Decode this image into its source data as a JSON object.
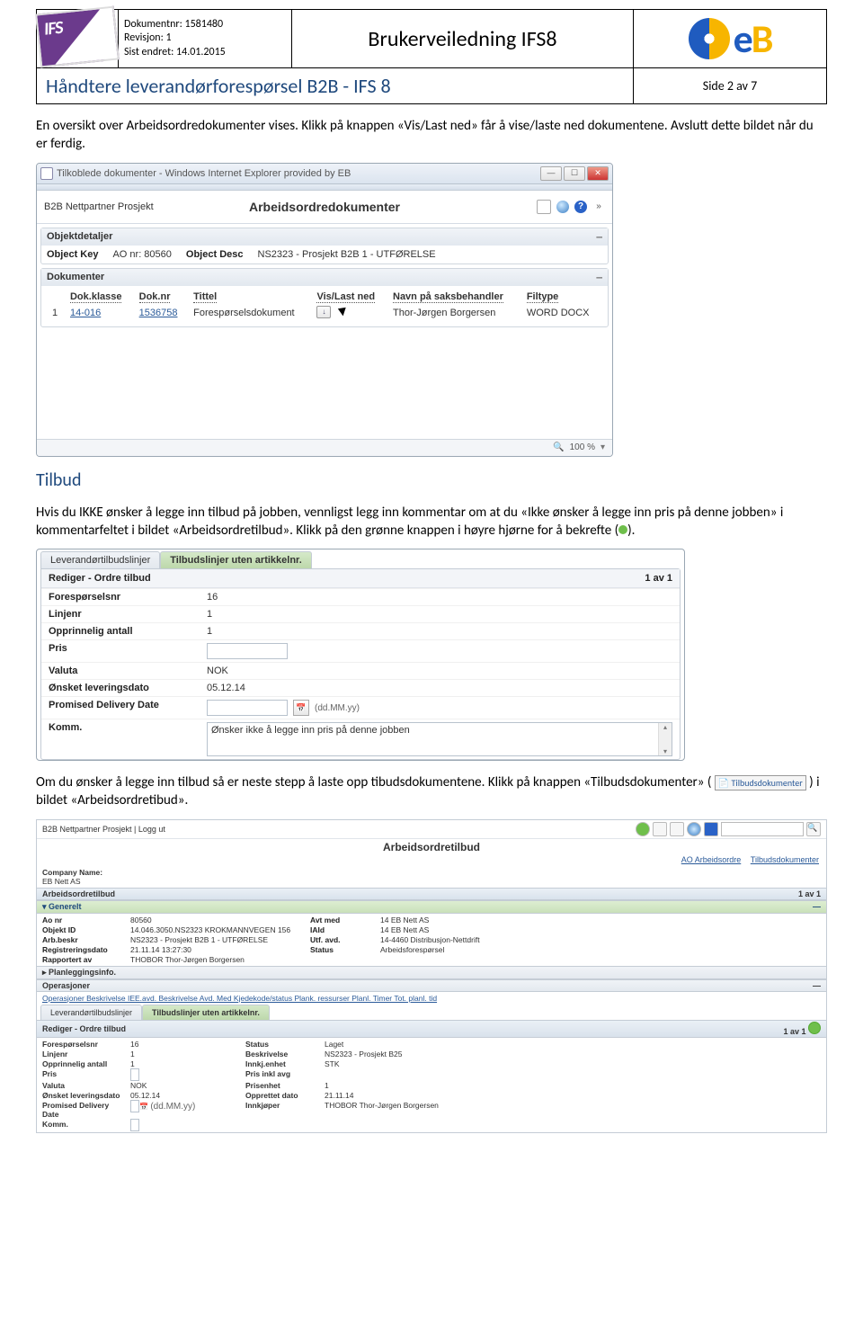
{
  "header": {
    "meta": {
      "docnr_label": "Dokumentnr:",
      "docnr": "1581480",
      "rev_label": "Revisjon:",
      "rev": "1",
      "changed_label": "Sist endret:",
      "changed": "14.01.2015"
    },
    "title": "Brukerveiledning IFS8",
    "row2_left": "Håndtere leverandørforespørsel B2B - IFS 8",
    "row2_right": "Side 2 av 7"
  },
  "para1": "En oversikt over Arbeidsordredokumenter vises. Klikk på knappen «Vis/Last ned» får å vise/laste ned dokumentene. Avslutt dette bildet når du er ferdig.",
  "shot1": {
    "window_title": "Tilkoblede dokumenter - Windows Internet Explorer provided by EB",
    "crumb": "B2B Nettpartner Prosjekt",
    "page_title": "Arbeidsordredokumenter",
    "panel1_title": "Objektdetaljer",
    "obj": {
      "key_label": "Object Key",
      "key_value": "AO nr: 80560",
      "desc_label": "Object Desc",
      "desc_value": "NS2323 - Prosjekt B2B 1 - UTFØRELSE"
    },
    "panel2_title": "Dokumenter",
    "cols": [
      "Dok.klasse",
      "Dok.nr",
      "Tittel",
      "Vis/Last ned",
      "Navn på saksbehandler",
      "Filtype"
    ],
    "row": {
      "idx": "1",
      "klasse": "14-016",
      "nr": "1536758",
      "tittel": "Forespørselsdokument",
      "saksbehandler": "Thor-Jørgen Borgersen",
      "filtype": "WORD DOCX"
    },
    "zoom": "100 %"
  },
  "section_tilbud": "Tilbud",
  "para2a": "Hvis du IKKE ønsker å legge inn tilbud på jobben, vennligst legg inn kommentar om at du «Ikke ønsker å legge inn pris på denne jobben» i kommentarfeltet i bildet «Arbeidsordretilbud». Klikk på den grønne knappen i høyre hjørne for å bekrefte (",
  "para2b": ").",
  "shot2": {
    "tab1": "Leverandørtilbudslinjer",
    "tab2": "Tilbudslinjer uten artikkelnr.",
    "form_title": "Rediger - Ordre tilbud",
    "pager": "1 av 1",
    "rows": [
      {
        "label": "Forespørselsnr",
        "value": "16",
        "type": "text"
      },
      {
        "label": "Linjenr",
        "value": "1",
        "type": "text"
      },
      {
        "label": "Opprinnelig antall",
        "value": "1",
        "type": "text"
      },
      {
        "label": "Pris",
        "value": "",
        "type": "input"
      },
      {
        "label": "Valuta",
        "value": "NOK",
        "type": "text"
      },
      {
        "label": "Ønsket leveringsdato",
        "value": "05.12.14",
        "type": "text"
      },
      {
        "label": "Promised Delivery Date",
        "value": "",
        "type": "date",
        "hint": "(dd.MM.yy)"
      },
      {
        "label": "Komm.",
        "value": "Ønsker ikke å legge inn pris på denne jobben",
        "type": "textarea"
      }
    ]
  },
  "para3a": "Om du ønsker å legge inn tilbud så er neste stepp å laste opp tibudsdokumentene. Klikk på knappen «Tilbudsdokumenter» (",
  "para3b": ") i bildet «Arbeidsordretibud».",
  "inline_btn_label": "Tilbudsdokumenter",
  "shot3": {
    "crumb": "B2B Nettpartner Prosjekt | Logg ut",
    "title": "Arbeidsordretilbud",
    "link1": "AO Arbeidsordre",
    "link2": "Tilbudsdokumenter",
    "company_label": "Company Name:",
    "company": "EB Nett AS",
    "sec_tilbud": "Arbeidsordretilbud",
    "pager": "1 av 1",
    "sec_generelt": "Generelt",
    "g": {
      "ao_nr_l": "Ao nr",
      "ao_nr": "80560",
      "avt_med_l": "Avt med",
      "avt_med": "14  EB Nett AS",
      "objid_l": "Objekt ID",
      "objid": "14.046.3050.NS2323  KROKMANNVEGEN 156",
      "id_l": "IAId",
      "id": "14  EB Nett AS",
      "arbb_l": "Arb.beskr",
      "arbb": "NS2323 - Prosjekt B2B 1 - UTFØRELSE",
      "utf_l": "Utf. avd.",
      "utf": "14-4460  Distribusjon-Nettdrift",
      "regd_l": "Registreringsdato",
      "regd": "21.11.14 13:27:30",
      "status_l": "Status",
      "status": "Arbeidsforespørsel",
      "rapp_l": "Rapportert av",
      "rapp": "THOBOR  Thor-Jørgen Borgersen"
    },
    "sec_plan": "Planleggingsinfo.",
    "sec_ops": "Operasjoner",
    "ops_text": "Operasjoner Beskrivelse IEE.avd. Beskrivelse Avd. Med Kjedekode/status Plank. ressurser Planl. Timer Tot. planl. tid",
    "sec_lev": "Leverandørtilbudslinjer",
    "sec_tab2": "Tilbudslinjer uten artikkelnr.",
    "form_title": "Rediger - Ordre tilbud",
    "pager2": "1 av 1",
    "f": {
      "fnr_l": "Forespørselsnr",
      "fnr": "16",
      "status_l": "Status",
      "status": "Laget",
      "linje_l": "Linjenr",
      "linje": "1",
      "besk_l": "Beskrivelse",
      "besk": "NS2323 - Prosjekt B25",
      "antall_l": "Opprinnelig antall",
      "antall": "1",
      "enh_l": "Innkj.enhet",
      "enh": "STK",
      "pris_l": "Pris",
      "pris": "",
      "prisink_l": "Pris inkl avg",
      "prisink": "",
      "valuta_l": "Valuta",
      "valuta": "NOK",
      "priskd_l": "Prisenhet",
      "priskd": "1",
      "lev_l": "Ønsket leveringsdato",
      "lev": "05.12.14",
      "oppd_l": "Opprettet dato",
      "oppd": "21.11.14",
      "prom_l": "Promised Delivery Date",
      "prom_hint": "(dd.MM.yy)",
      "innk_l": "Innkjøper",
      "innk": "THOBOR    Thor-Jørgen Borgersen",
      "komm_l": "Komm."
    }
  }
}
